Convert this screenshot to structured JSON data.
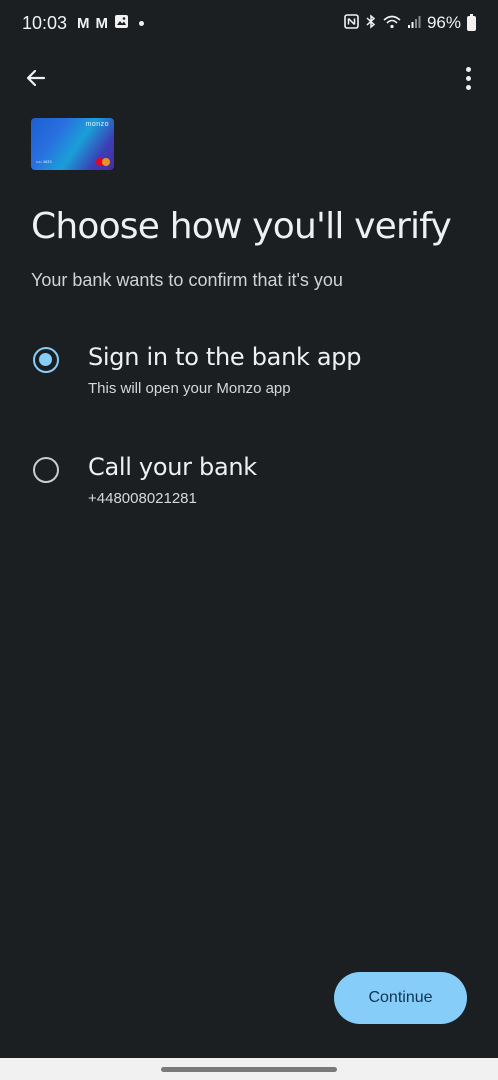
{
  "status_bar": {
    "time": "10:03",
    "notification_icons": [
      "gmail-icon",
      "gmail-icon",
      "gallery-icon"
    ],
    "battery": "96%"
  },
  "app_bar": {
    "back_icon": "arrow-left-icon",
    "more_icon": "more-vert-icon"
  },
  "card": {
    "brand": "monzo",
    "number": "•••• 4633"
  },
  "title": "Choose how you'll verify",
  "subtitle": "Your bank wants to confirm that it's you",
  "options": [
    {
      "label": "Sign in to the bank app",
      "description": "This will open your Monzo app",
      "selected": true
    },
    {
      "label": "Call your bank",
      "description": "+448008021281",
      "selected": false
    }
  ],
  "continue_label": "Continue",
  "colors": {
    "background": "#1c1f22",
    "accent": "#86cdf9",
    "button_text": "#0e3550"
  }
}
